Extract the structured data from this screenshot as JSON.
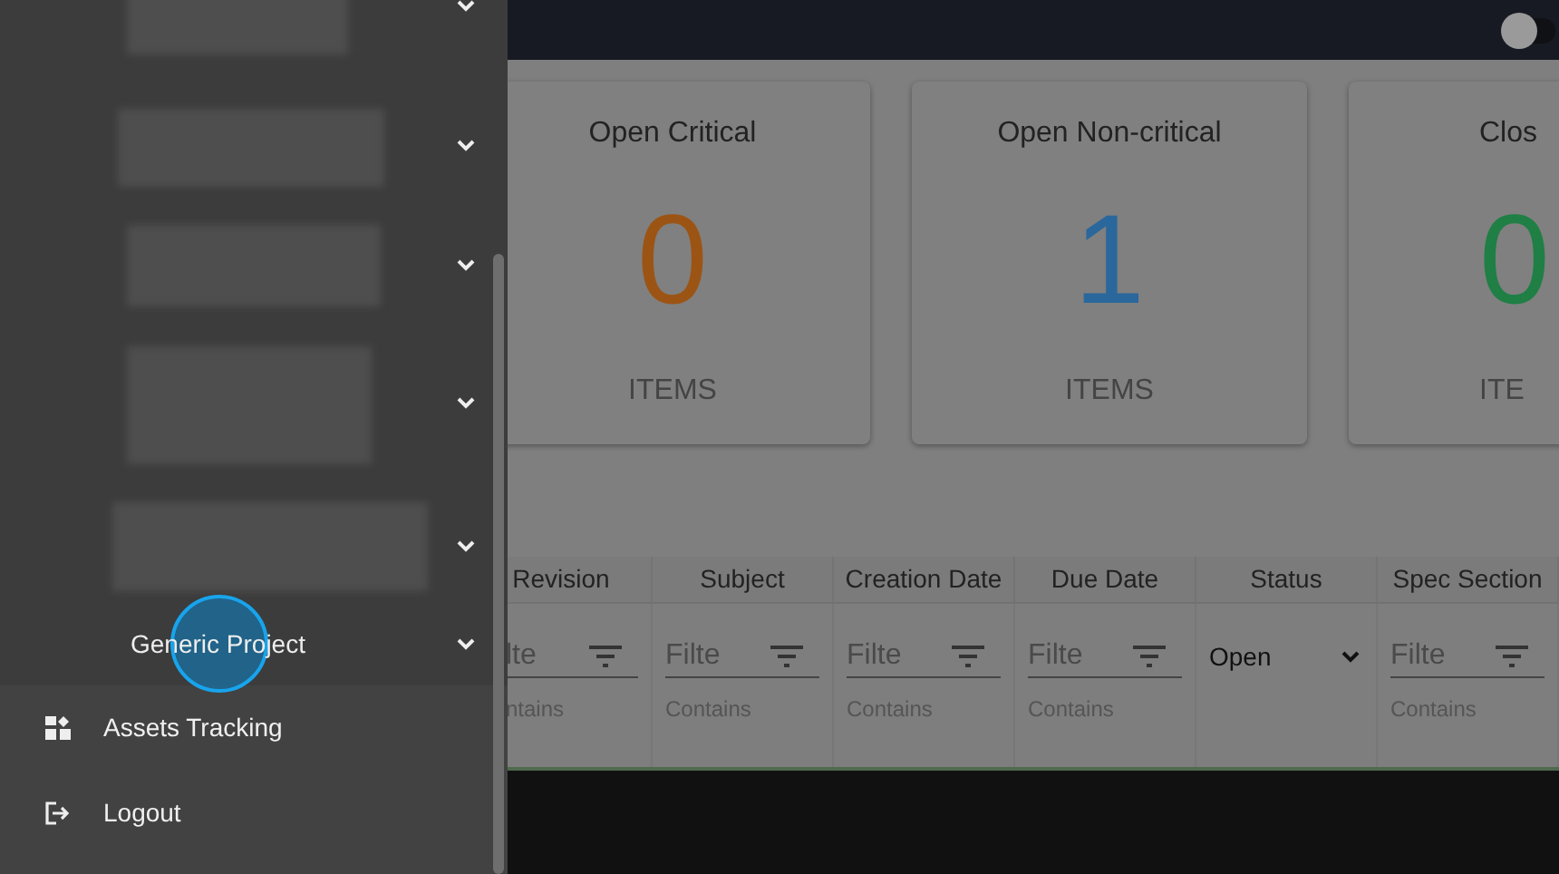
{
  "top_bar": {
    "toggle": {
      "on": false
    }
  },
  "cards": [
    {
      "title": "Open Critical",
      "count": "0",
      "unit": "ITEMS",
      "color": "#9c5414"
    },
    {
      "title": "Open Non-critical",
      "count": "1",
      "unit": "ITEMS",
      "color": "#2a679c"
    },
    {
      "title": "Clos",
      "count": "0",
      "unit": "ITE",
      "color": "#1f7f45"
    }
  ],
  "table": {
    "columns": [
      {
        "label": "Revision",
        "kind": "text",
        "placeholder": "lte",
        "mode": "ntains"
      },
      {
        "label": "Subject",
        "kind": "text",
        "placeholder": "Filte",
        "mode": "Contains"
      },
      {
        "label": "Creation Date",
        "kind": "text",
        "placeholder": "Filte",
        "mode": "Contains"
      },
      {
        "label": "Due Date",
        "kind": "text",
        "placeholder": "Filte",
        "mode": "Contains"
      },
      {
        "label": "Status",
        "kind": "select",
        "value": "Open"
      },
      {
        "label": "Spec Section",
        "kind": "text",
        "placeholder": "Filte",
        "mode": "Contains"
      }
    ]
  },
  "sidebar": {
    "projects": [
      {
        "kind": "redacted"
      },
      {
        "kind": "redacted"
      },
      {
        "kind": "redacted"
      },
      {
        "kind": "redacted"
      },
      {
        "kind": "redacted"
      },
      {
        "kind": "project",
        "label": "Generic Project",
        "clicked": true
      }
    ],
    "items": [
      {
        "label": "Assets Tracking"
      },
      {
        "label": "Logout"
      }
    ]
  }
}
